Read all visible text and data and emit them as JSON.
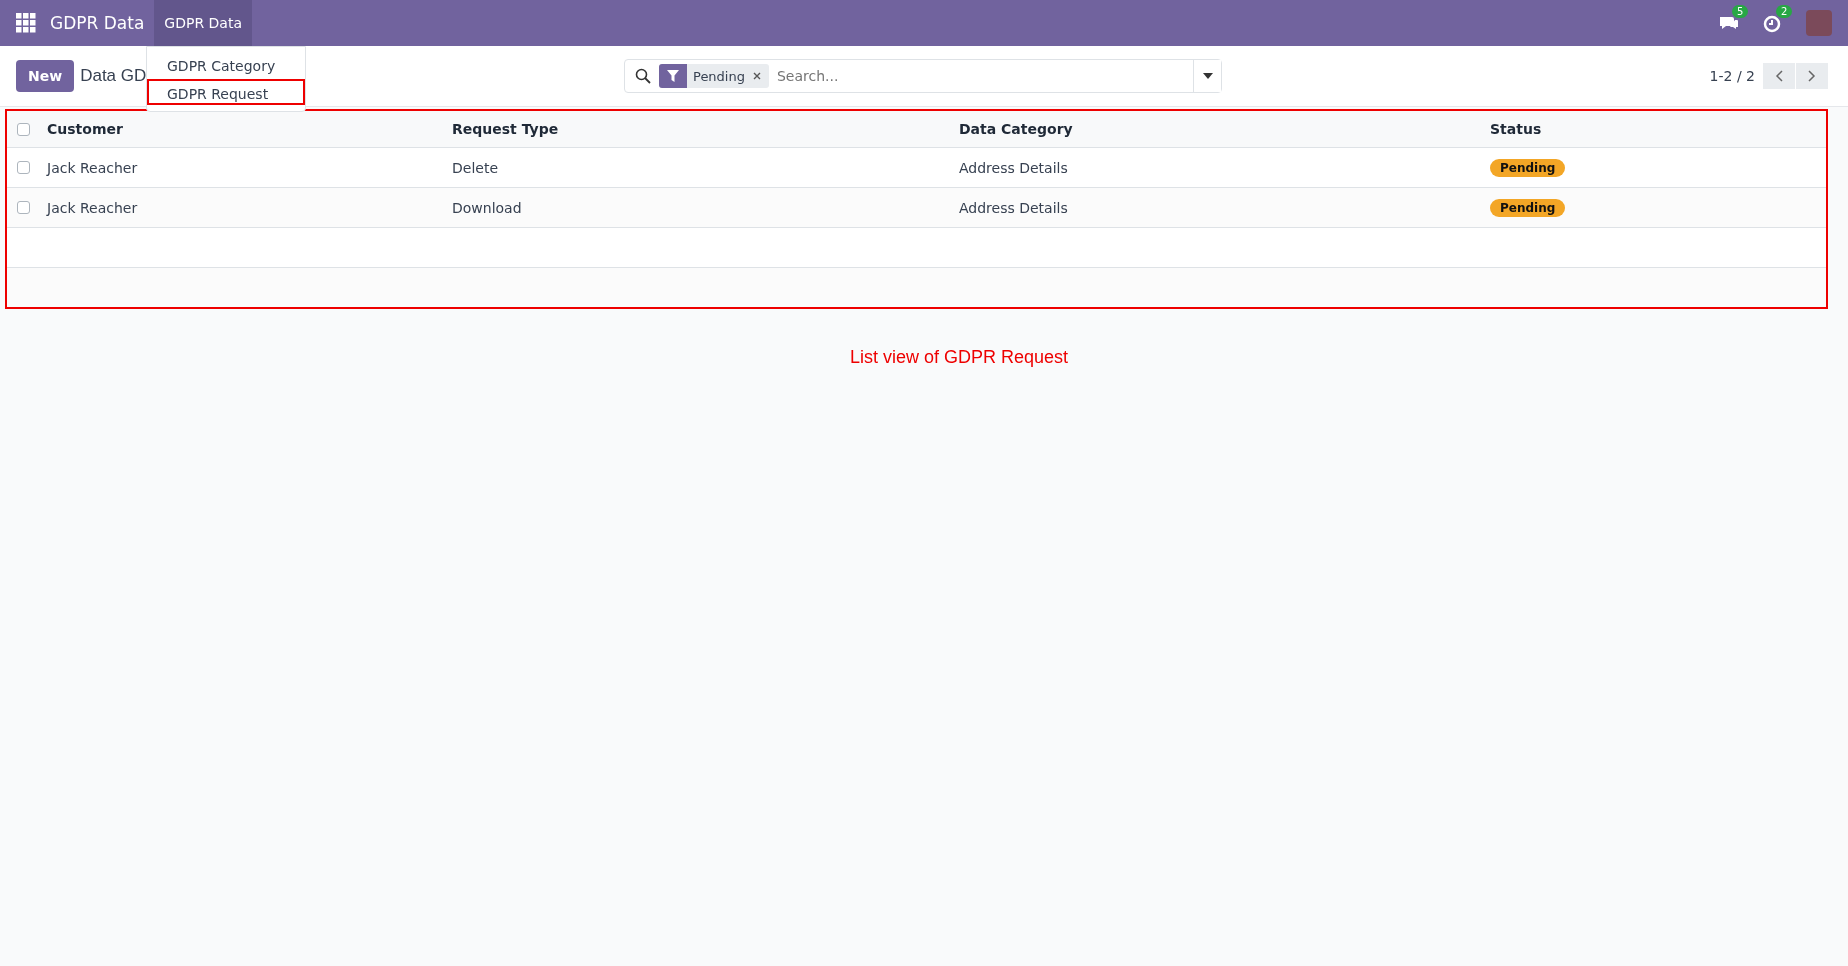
{
  "navbar": {
    "app_title": "GDPR Data",
    "menus": [
      {
        "label": "GDPR Data",
        "selected": true,
        "items": [
          {
            "label": "GDPR Category",
            "selected": false
          },
          {
            "label": "GDPR Request",
            "selected": true
          }
        ]
      }
    ],
    "messages_count": "5",
    "activities_count": "2"
  },
  "control_panel": {
    "new_button": "New",
    "breadcrumb": "Data GD",
    "search": {
      "placeholder": "Search...",
      "facets": [
        {
          "label": "Pending"
        }
      ]
    },
    "pager": "1-2 / 2"
  },
  "table": {
    "columns": [
      "Customer",
      "Request Type",
      "Data Category",
      "Status"
    ],
    "all_checked": false,
    "rows": [
      {
        "checked": false,
        "customer": "Jack Reacher",
        "request_type": "Delete",
        "data_category": "Address Details",
        "status": "Pending"
      },
      {
        "checked": false,
        "customer": "Jack Reacher",
        "request_type": "Download",
        "data_category": "Address Details",
        "status": "Pending"
      }
    ]
  },
  "caption": "List view of GDPR Request"
}
